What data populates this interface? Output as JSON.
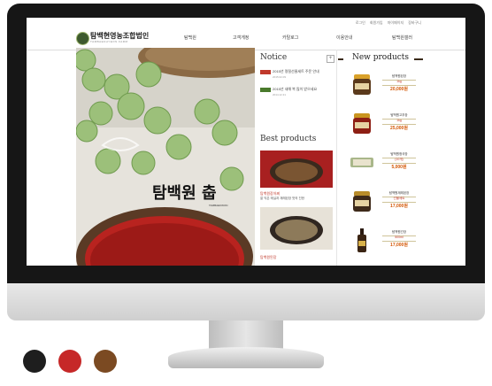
{
  "colors": {
    "swatch1": "#1e1e1e",
    "swatch2": "#c62828",
    "swatch3": "#7b4a22",
    "accent": "#d35400"
  },
  "site": {
    "top_links": [
      "로그인",
      "회원가입",
      "마이페이지",
      "장바구니"
    ],
    "logo_text": "탐백현영농조합법인",
    "logo_sub": "TAMBAEKHYEON FARM",
    "nav": [
      "탐백원",
      "고객게정",
      "카탈로그",
      "이용안내",
      "탐백원갤러"
    ],
    "hero_text": "탐백원 춥",
    "hero_sub": "TAMBAEKWON",
    "notice": {
      "title": "Notice",
      "items": [
        {
          "text": "2015년 명절선물세트 주문 안내",
          "date": "2015.02.09"
        },
        {
          "text": "2015년 새해 복 많이 받으세요",
          "date": "2014.12.31"
        }
      ]
    },
    "best": {
      "title": "Best products",
      "items": [
        {
          "name": "탐백원장아찌",
          "desc": "잘 익은 매실과 재래된장 맛의 진한"
        },
        {
          "name": "탐백원된장",
          "desc": "소금으로 만든 김장김치의 맛"
        }
      ]
    },
    "new_products": {
      "title": "New products",
      "items": [
        {
          "name": "탐백원된장",
          "weight": "1kg",
          "price": "20,000원"
        },
        {
          "name": "탐백원고추장",
          "weight": "1kg",
          "price": "25,000원"
        },
        {
          "name": "탐백원청국장",
          "weight": "(10개)",
          "price": "5,000원"
        },
        {
          "name": "탐백원재래된장",
          "weight": "선물세트",
          "price": "17,000원"
        },
        {
          "name": "탐백원간장",
          "weight": "500ml",
          "price": "17,000원"
        }
      ]
    }
  }
}
